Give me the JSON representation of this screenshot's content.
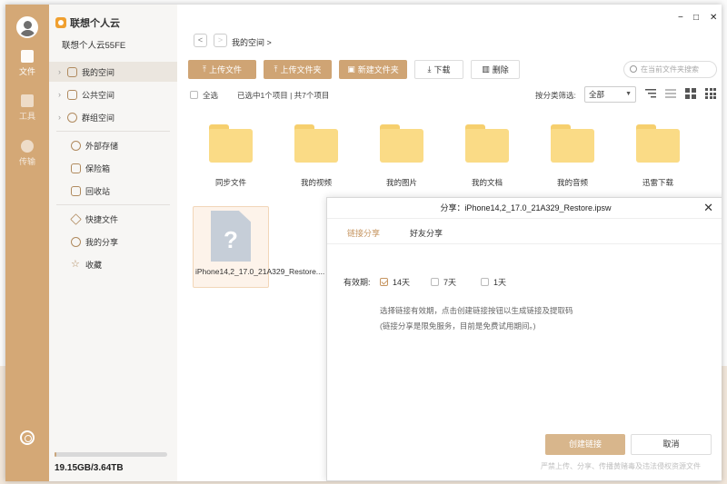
{
  "rail": {
    "items": [
      {
        "label": "文件"
      },
      {
        "label": "工具"
      },
      {
        "label": "传输"
      }
    ]
  },
  "app": {
    "name": "联想个人云",
    "account": "联想个人云55FE"
  },
  "sidebar": {
    "items": [
      {
        "label": "我的空间"
      },
      {
        "label": "公共空间"
      },
      {
        "label": "群组空间"
      },
      {
        "label": "外部存储"
      },
      {
        "label": "保险箱"
      },
      {
        "label": "回收站"
      },
      {
        "label": "快捷文件"
      },
      {
        "label": "我的分享"
      },
      {
        "label": "收藏"
      }
    ],
    "storage": {
      "text": "19.15GB/3.64TB",
      "used_fraction": 0.005
    }
  },
  "window_controls": {
    "minimize": "−",
    "maximize": "□",
    "close": "✕"
  },
  "nav": {
    "back": "<",
    "forward": ">",
    "breadcrumb": "我的空间 >"
  },
  "toolbar": {
    "upload_file": "上传文件",
    "upload_folder": "上传文件夹",
    "new_folder": "新建文件夹",
    "download": "下载",
    "delete": "删除"
  },
  "search": {
    "placeholder": "在当前文件夹搜索"
  },
  "infobar": {
    "select_all": "全选",
    "selection": "已选中1个项目 | 共7个项目",
    "sort_label": "按分类筛选:",
    "sort_value": "全部"
  },
  "files": [
    {
      "name": "同步文件"
    },
    {
      "name": "我的视频"
    },
    {
      "name": "我的图片"
    },
    {
      "name": "我的文档"
    },
    {
      "name": "我的音频"
    },
    {
      "name": "迅雷下载"
    },
    {
      "name": "iPhone14,2_17.0_21A329_Restore...."
    }
  ],
  "dialog": {
    "title": "分享：iPhone14,2_17.0_21A329_Restore.ipsw",
    "close": "✕",
    "tab_link": "链接分享",
    "tab_friend": "好友分享",
    "validity_label": "有效期:",
    "options": [
      {
        "label": "14天",
        "checked": true
      },
      {
        "label": "7天",
        "checked": false
      },
      {
        "label": "1天",
        "checked": false
      }
    ],
    "hint1": "选择链接有效期，点击创建链接按钮以生成链接及提取码",
    "hint2": "(链接分享是限免服务，目前是免费试用期间。)",
    "create_button": "创建链接",
    "cancel_button": "取消",
    "disclaimer": "严禁上传、分享、传播黄赌毒及违法侵权资源文件"
  }
}
